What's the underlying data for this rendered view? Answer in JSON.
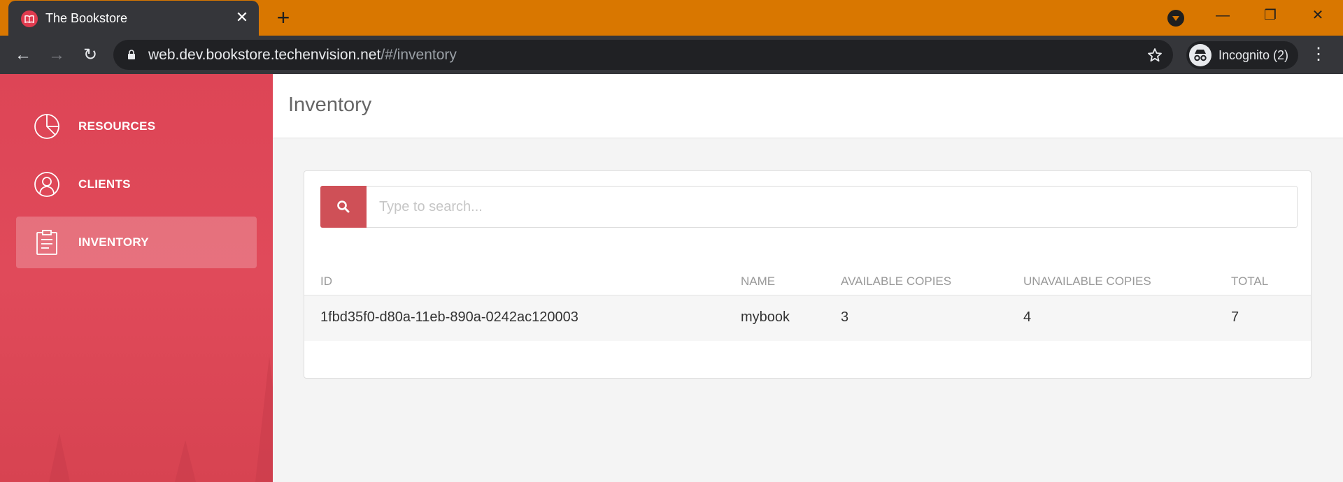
{
  "browser": {
    "tab_title": "The Bookstore",
    "url_host": "web.dev.bookstore.techenvision.net",
    "url_path": "/#/inventory",
    "profile_label": "Incognito (2)",
    "theme_color": "#d97700"
  },
  "sidebar": {
    "items": [
      {
        "label": "RESOURCES",
        "icon": "pie-chart-icon",
        "active": false
      },
      {
        "label": "CLIENTS",
        "icon": "user-icon",
        "active": false
      },
      {
        "label": "INVENTORY",
        "icon": "clipboard-icon",
        "active": true
      }
    ],
    "accent_color": "#dd4556"
  },
  "page": {
    "title": "Inventory"
  },
  "search": {
    "placeholder": "Type to search...",
    "value": ""
  },
  "table": {
    "columns": [
      "ID",
      "NAME",
      "AVAILABLE COPIES",
      "UNAVAILABLE COPIES",
      "TOTAL"
    ],
    "rows": [
      {
        "id": "1fbd35f0-d80a-11eb-890a-0242ac120003",
        "name": "mybook",
        "available": "3",
        "unavailable": "4",
        "total": "7"
      }
    ]
  }
}
